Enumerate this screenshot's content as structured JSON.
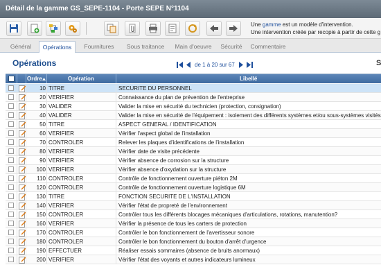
{
  "window": {
    "title": "Détail de la gamme GS_SEPE-1104 - Porte SEPE N°1104"
  },
  "toolbar": {
    "buttons": [
      {
        "name": "save-button",
        "icon": "floppy-icon"
      },
      {
        "name": "add-button",
        "icon": "add-document-icon"
      },
      {
        "name": "hierarchy-button",
        "icon": "hierarchy-icon"
      },
      {
        "name": "gears-button",
        "icon": "gears-icon"
      },
      {
        "name": "copy-button",
        "icon": "copy-icon"
      },
      {
        "name": "attach-button",
        "icon": "paperclip-icon"
      },
      {
        "name": "print-button",
        "icon": "printer-icon"
      },
      {
        "name": "report-button",
        "icon": "report-icon"
      },
      {
        "name": "refresh-button",
        "icon": "refresh-icon"
      },
      {
        "name": "previous-button",
        "icon": "arrow-left-icon"
      },
      {
        "name": "next-button",
        "icon": "arrow-right-icon"
      }
    ]
  },
  "info": {
    "line1_prefix": "Une ",
    "line1_highlight": "gamme",
    "line1_suffix": " est un modèle d'intervention.",
    "line2": "Une intervention créée par recopie à partir de cette g"
  },
  "tabs": [
    {
      "label": "Général",
      "active": false
    },
    {
      "label": "Opérations",
      "active": true
    },
    {
      "label": "Fournitures",
      "active": false
    },
    {
      "label": "Sous traitance",
      "active": false
    },
    {
      "label": "Main d'oeuvre",
      "active": false
    },
    {
      "label": "Sécurité",
      "active": false
    },
    {
      "label": "Commentaire",
      "active": false
    }
  ],
  "section": {
    "title": "Opérations",
    "pager_text": "de 1 à 20 sur 67",
    "settings_glyph": "S"
  },
  "grid": {
    "headers": {
      "ordre": "Ordre",
      "operation": "Opération",
      "libelle": "Libellé"
    },
    "rows": [
      {
        "ordre": "10",
        "operation": "TITRE",
        "libelle": "SECURITE DU PERSONNEL",
        "selected": true
      },
      {
        "ordre": "20",
        "operation": "VERIFIER",
        "libelle": "Connaissance du plan de prévention de l'entreprise"
      },
      {
        "ordre": "30",
        "operation": "VALIDER",
        "libelle": "Valider la mise en sécurité du technicien (protection, consignation)"
      },
      {
        "ordre": "40",
        "operation": "VALIDER",
        "libelle": "Valider la mise en sécurité de l'équipement : isolement des différents systèmes et/ou sous-systèmes visités"
      },
      {
        "ordre": "50",
        "operation": "TITRE",
        "libelle": "ASPECT GENERAL / IDENTIFICATION"
      },
      {
        "ordre": "60",
        "operation": "VERIFIER",
        "libelle": "Vérifier l'aspect global de l'installation"
      },
      {
        "ordre": "70",
        "operation": "CONTROLER",
        "libelle": "Relever les plaques d'identifications de l'installation"
      },
      {
        "ordre": "80",
        "operation": "VERIFIER",
        "libelle": "Vérifier date de visite précédente"
      },
      {
        "ordre": "90",
        "operation": "VERIFIER",
        "libelle": "Vérifier absence de corrosion sur la structure"
      },
      {
        "ordre": "100",
        "operation": "VERIFIER",
        "libelle": "Vérifier absence d'oxydation sur la structure"
      },
      {
        "ordre": "110",
        "operation": "CONTROLER",
        "libelle": "Contrôle de fonctionnement ouverture piéton 2M"
      },
      {
        "ordre": "120",
        "operation": "CONTROLER",
        "libelle": "Contrôle de fonctionnement ouverture logistique 6M"
      },
      {
        "ordre": "130",
        "operation": "TITRE",
        "libelle": "FONCTION SECURITE DE L'INSTALLATION"
      },
      {
        "ordre": "140",
        "operation": "VERIFIER",
        "libelle": "Vérifier l'état de propreté de l'environnement"
      },
      {
        "ordre": "150",
        "operation": "CONTROLER",
        "libelle": "Contrôler tous les différents blocages mécaniques d'articulations, rotations, manutention?"
      },
      {
        "ordre": "160",
        "operation": "VERIFIER",
        "libelle": "Vérifier la présence de tous les carters de protection"
      },
      {
        "ordre": "170",
        "operation": "CONTROLER",
        "libelle": "Contrôler le bon fonctionnement de l'avertisseur sonore"
      },
      {
        "ordre": "180",
        "operation": "CONTROLER",
        "libelle": "Contrôler le bon fonctionnement du bouton d'arrêt d'urgence"
      },
      {
        "ordre": "190",
        "operation": "EFFECTUER",
        "libelle": "Réaliser essais sommaires (absence de bruits anormaux)"
      },
      {
        "ordre": "200",
        "operation": "VERIFIER",
        "libelle": "Vérifier l'état des voyants et autres indicateurs lumineux"
      }
    ]
  },
  "colors": {
    "accent": "#1e4f9c",
    "header": "#4a75aa",
    "selected_row": "#cde3f7",
    "edit_icon": "#e07a10"
  }
}
